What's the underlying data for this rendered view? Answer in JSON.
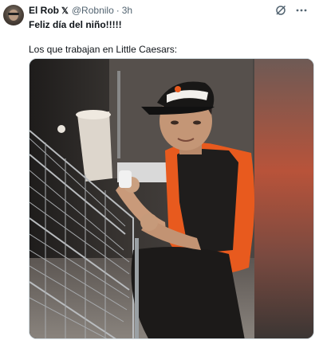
{
  "author": {
    "name": "El Rob",
    "badge": "𝕏",
    "handle": "@Robnilo",
    "separator": "·",
    "time": "3h"
  },
  "icons": {
    "grok": "grok-icon",
    "more": "more-options-icon"
  },
  "tweet": {
    "line1": "Feliz día del niño!!!!!",
    "line2": "Los que trabajan en Little Caesars:"
  },
  "colors": {
    "text": "#0f1419",
    "secondary": "#536471",
    "shirt_orange": "#e85a1e",
    "media_border": "#cfd9de"
  }
}
